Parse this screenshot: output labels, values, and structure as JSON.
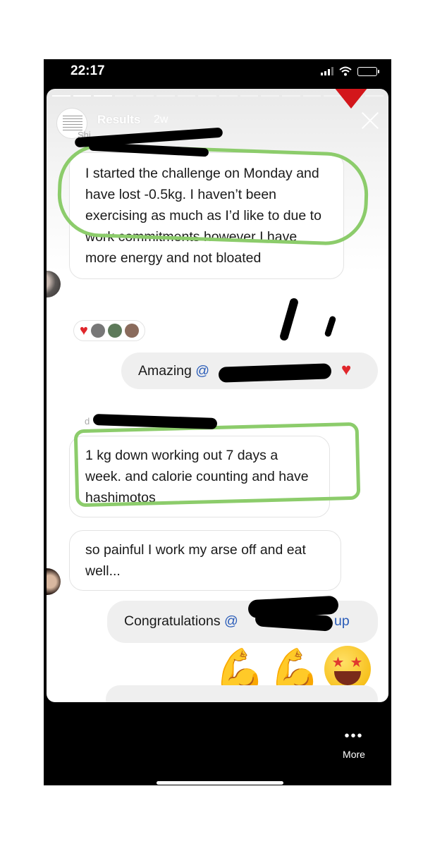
{
  "status_bar": {
    "time": "22:17"
  },
  "story": {
    "title": "Results",
    "age": "2w"
  },
  "messages": [
    {
      "sender_visible": "Shi",
      "text": "I started the challenge on Monday and have lost -0.5kg. I haven’t been exercising as much as I’d like to due to work commitments however I have more energy and not bloated",
      "reactions": [
        "heart",
        "avatar",
        "avatar",
        "avatar"
      ]
    },
    {
      "direction": "outgoing",
      "text": "Amazing ",
      "mention_visible": "@"
    },
    {
      "sender_visible": "d",
      "text": "1 kg down working out 7 days a week. and calorie counting and have hashimotos"
    },
    {
      "text": "so painful I work my arse off and eat well..."
    },
    {
      "direction": "outgoing",
      "text": "Congratulations ",
      "mention_visible": "@",
      "mention_tail": "up"
    }
  ],
  "emojis": [
    "flexed-biceps",
    "flexed-biceps",
    "star-struck"
  ],
  "bottom_bar": {
    "more_label": "More"
  },
  "colors": {
    "highlight_circle": "#8ccc6b",
    "mention": "#2a5cb8",
    "heart": "#e0262b"
  }
}
